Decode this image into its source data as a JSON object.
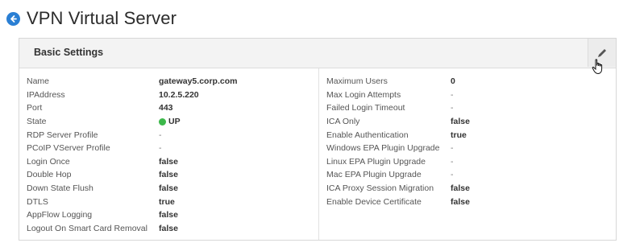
{
  "page": {
    "title": "VPN Virtual Server"
  },
  "panel": {
    "title": "Basic Settings"
  },
  "left_fields": [
    {
      "label": "Name",
      "value": "gateway5.corp.com"
    },
    {
      "label": "IPAddress",
      "value": "10.2.5.220"
    },
    {
      "label": "Port",
      "value": "443"
    },
    {
      "label": "State",
      "value": "UP"
    },
    {
      "label": "RDP Server Profile",
      "value": "-"
    },
    {
      "label": "PCoIP VServer Profile",
      "value": "-"
    },
    {
      "label": "Login Once",
      "value": "false"
    },
    {
      "label": "Double Hop",
      "value": "false"
    },
    {
      "label": "Down State Flush",
      "value": "false"
    },
    {
      "label": "DTLS",
      "value": "true"
    },
    {
      "label": "AppFlow Logging",
      "value": "false"
    },
    {
      "label": "Logout On Smart Card Removal",
      "value": "false"
    }
  ],
  "right_fields": [
    {
      "label": "Maximum Users",
      "value": "0"
    },
    {
      "label": "Max Login Attempts",
      "value": "-"
    },
    {
      "label": "Failed Login Timeout",
      "value": "-"
    },
    {
      "label": "ICA Only",
      "value": "false"
    },
    {
      "label": "Enable Authentication",
      "value": "true"
    },
    {
      "label": "Windows EPA Plugin Upgrade",
      "value": "-"
    },
    {
      "label": "Linux EPA Plugin Upgrade",
      "value": "-"
    },
    {
      "label": "Mac EPA Plugin Upgrade",
      "value": "-"
    },
    {
      "label": "ICA Proxy Session Migration",
      "value": "false"
    },
    {
      "label": "Enable Device Certificate",
      "value": "false"
    }
  ],
  "colors": {
    "accent": "#2a7fd4",
    "status_up": "#3cb84a"
  }
}
